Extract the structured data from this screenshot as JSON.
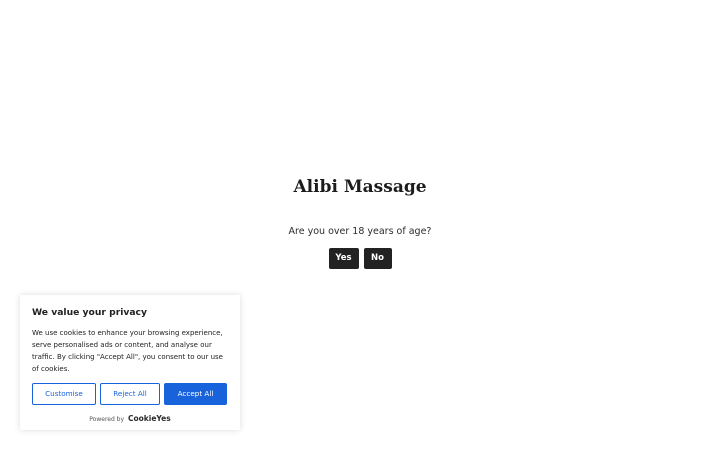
{
  "age_gate": {
    "title": "Alibi Massage",
    "question": "Are you over 18 years of age?",
    "yes_label": "Yes",
    "no_label": "No",
    "button_color": "#222222"
  },
  "cookie_banner": {
    "title": "We value your privacy",
    "text": "We use cookies to enhance your browsing experience, serve personalised ads or content, and analyse our traffic. By clicking \"Accept All\", you consent to our use of cookies.",
    "customise_label": "Customise",
    "reject_label": "Reject All",
    "accept_label": "Accept All",
    "powered_by": "Powered by",
    "brand": "CookieYes",
    "accent_color": "#1863dc"
  }
}
